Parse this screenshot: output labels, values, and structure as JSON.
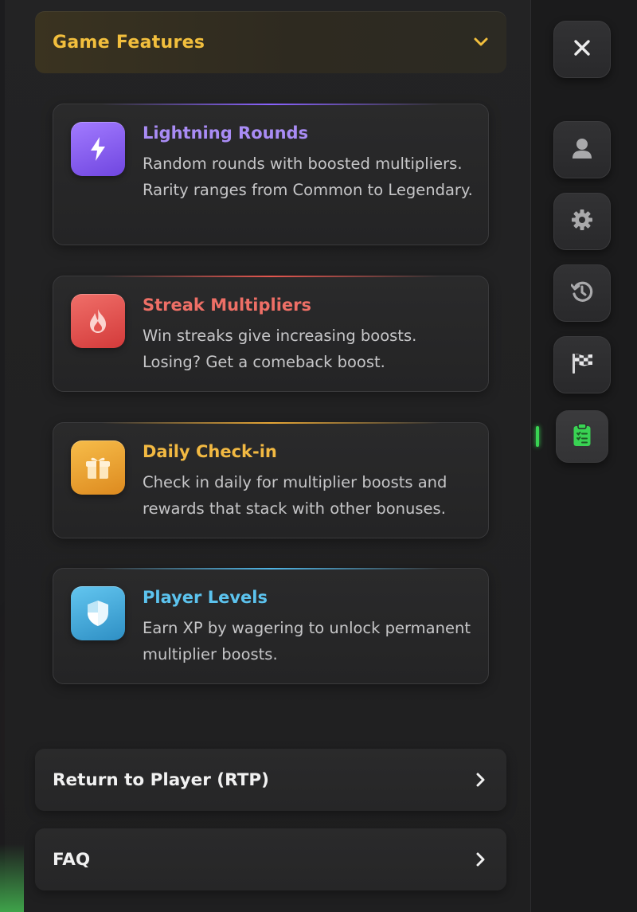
{
  "accordion": {
    "title": "Game Features",
    "expanded": true
  },
  "features": [
    {
      "title": "Lightning Rounds",
      "description": "Random rounds with boosted multipliers. Rarity ranges from Common to Legendary.",
      "icon": "lightning-icon",
      "title_color": "#a98cf5",
      "icon_gradient": [
        "#a27bff",
        "#7046e0"
      ],
      "line_color": "#8a63ff"
    },
    {
      "title": "Streak Multipliers",
      "description": "Win streaks give increasing boosts. Losing? Get a comeback boost.",
      "icon": "fire-icon",
      "title_color": "#ee6f66",
      "icon_gradient": [
        "#f06f69",
        "#d33a3a"
      ],
      "line_color": "#e4574f"
    },
    {
      "title": "Daily Check-in",
      "description": "Check in daily for multiplier boosts and rewards that stack with other bonuses.",
      "icon": "gift-icon",
      "title_color": "#f2b942",
      "icon_gradient": [
        "#f7bd4a",
        "#dd8a1f"
      ],
      "line_color": "#e6a636"
    },
    {
      "title": "Player Levels",
      "description": "Earn XP by wagering to unlock permanent multiplier boosts.",
      "icon": "shield-icon",
      "title_color": "#5cc3ee",
      "icon_gradient": [
        "#63c6f0",
        "#2e8fc4"
      ],
      "line_color": "#4fb4e4"
    }
  ],
  "sections": [
    {
      "label": "Return to Player (RTP)"
    },
    {
      "label": "FAQ"
    }
  ],
  "rail": {
    "buttons": [
      "close-icon",
      "user-icon",
      "gear-icon",
      "history-icon",
      "checkered-flag-icon",
      "clipboard-icon"
    ],
    "active": "clipboard-icon",
    "active_color": "#39d353"
  }
}
